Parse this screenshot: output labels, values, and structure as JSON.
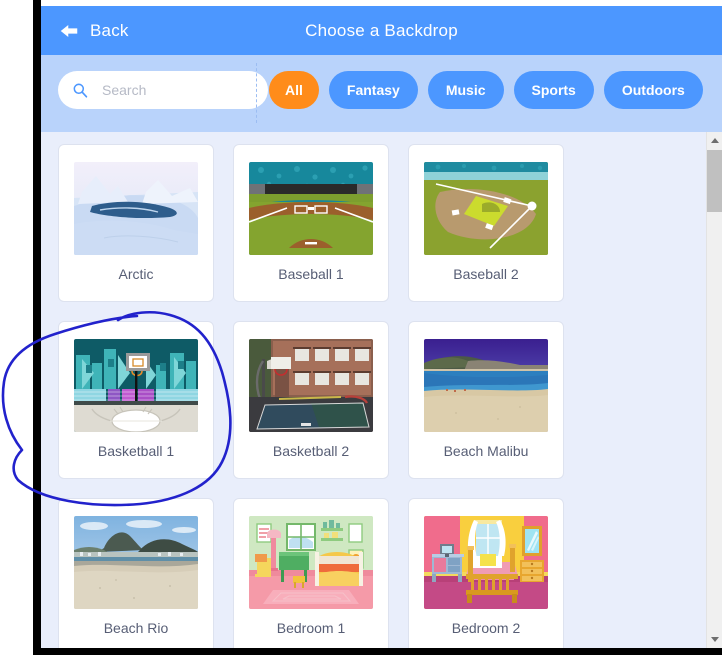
{
  "window": {
    "accent_blue": "#4c97ff",
    "filterbar_blue": "#b9d3fb",
    "selected_chip_orange": "#ff8c1a",
    "body_bg": "#e9eefb",
    "text_color": "#575e75",
    "annotation_color": "#2222cc"
  },
  "header": {
    "back_label": "Back",
    "back_icon": "arrow-left-icon",
    "title": "Choose a Backdrop"
  },
  "search": {
    "icon": "search-icon",
    "placeholder": "Search",
    "value": ""
  },
  "filters": [
    {
      "label": "All",
      "active": true
    },
    {
      "label": "Fantasy",
      "active": false
    },
    {
      "label": "Music",
      "active": false
    },
    {
      "label": "Sports",
      "active": false
    },
    {
      "label": "Outdoors",
      "active": false
    }
  ],
  "backdrops": [
    {
      "label": "Arctic",
      "thumb": "arctic-thumb"
    },
    {
      "label": "Baseball 1",
      "thumb": "baseball1-thumb"
    },
    {
      "label": "Baseball 2",
      "thumb": "baseball2-thumb"
    },
    {
      "label": "Basketball 1",
      "thumb": "basketball1-thumb"
    },
    {
      "label": "Basketball 2",
      "thumb": "basketball2-thumb"
    },
    {
      "label": "Beach Malibu",
      "thumb": "beachmalibu-thumb"
    },
    {
      "label": "Beach Rio",
      "thumb": "beachrio-thumb"
    },
    {
      "label": "Bedroom 1",
      "thumb": "bedroom1-thumb"
    },
    {
      "label": "Bedroom 2",
      "thumb": "bedroom2-thumb"
    }
  ],
  "scrollbar": {
    "up_icon": "triangle-up-icon",
    "down_icon": "triangle-down-icon",
    "thumb": "scroll-thumb"
  },
  "annotation": {
    "shape": "hand-drawn-ellipse",
    "target_label": "Basketball 1"
  }
}
